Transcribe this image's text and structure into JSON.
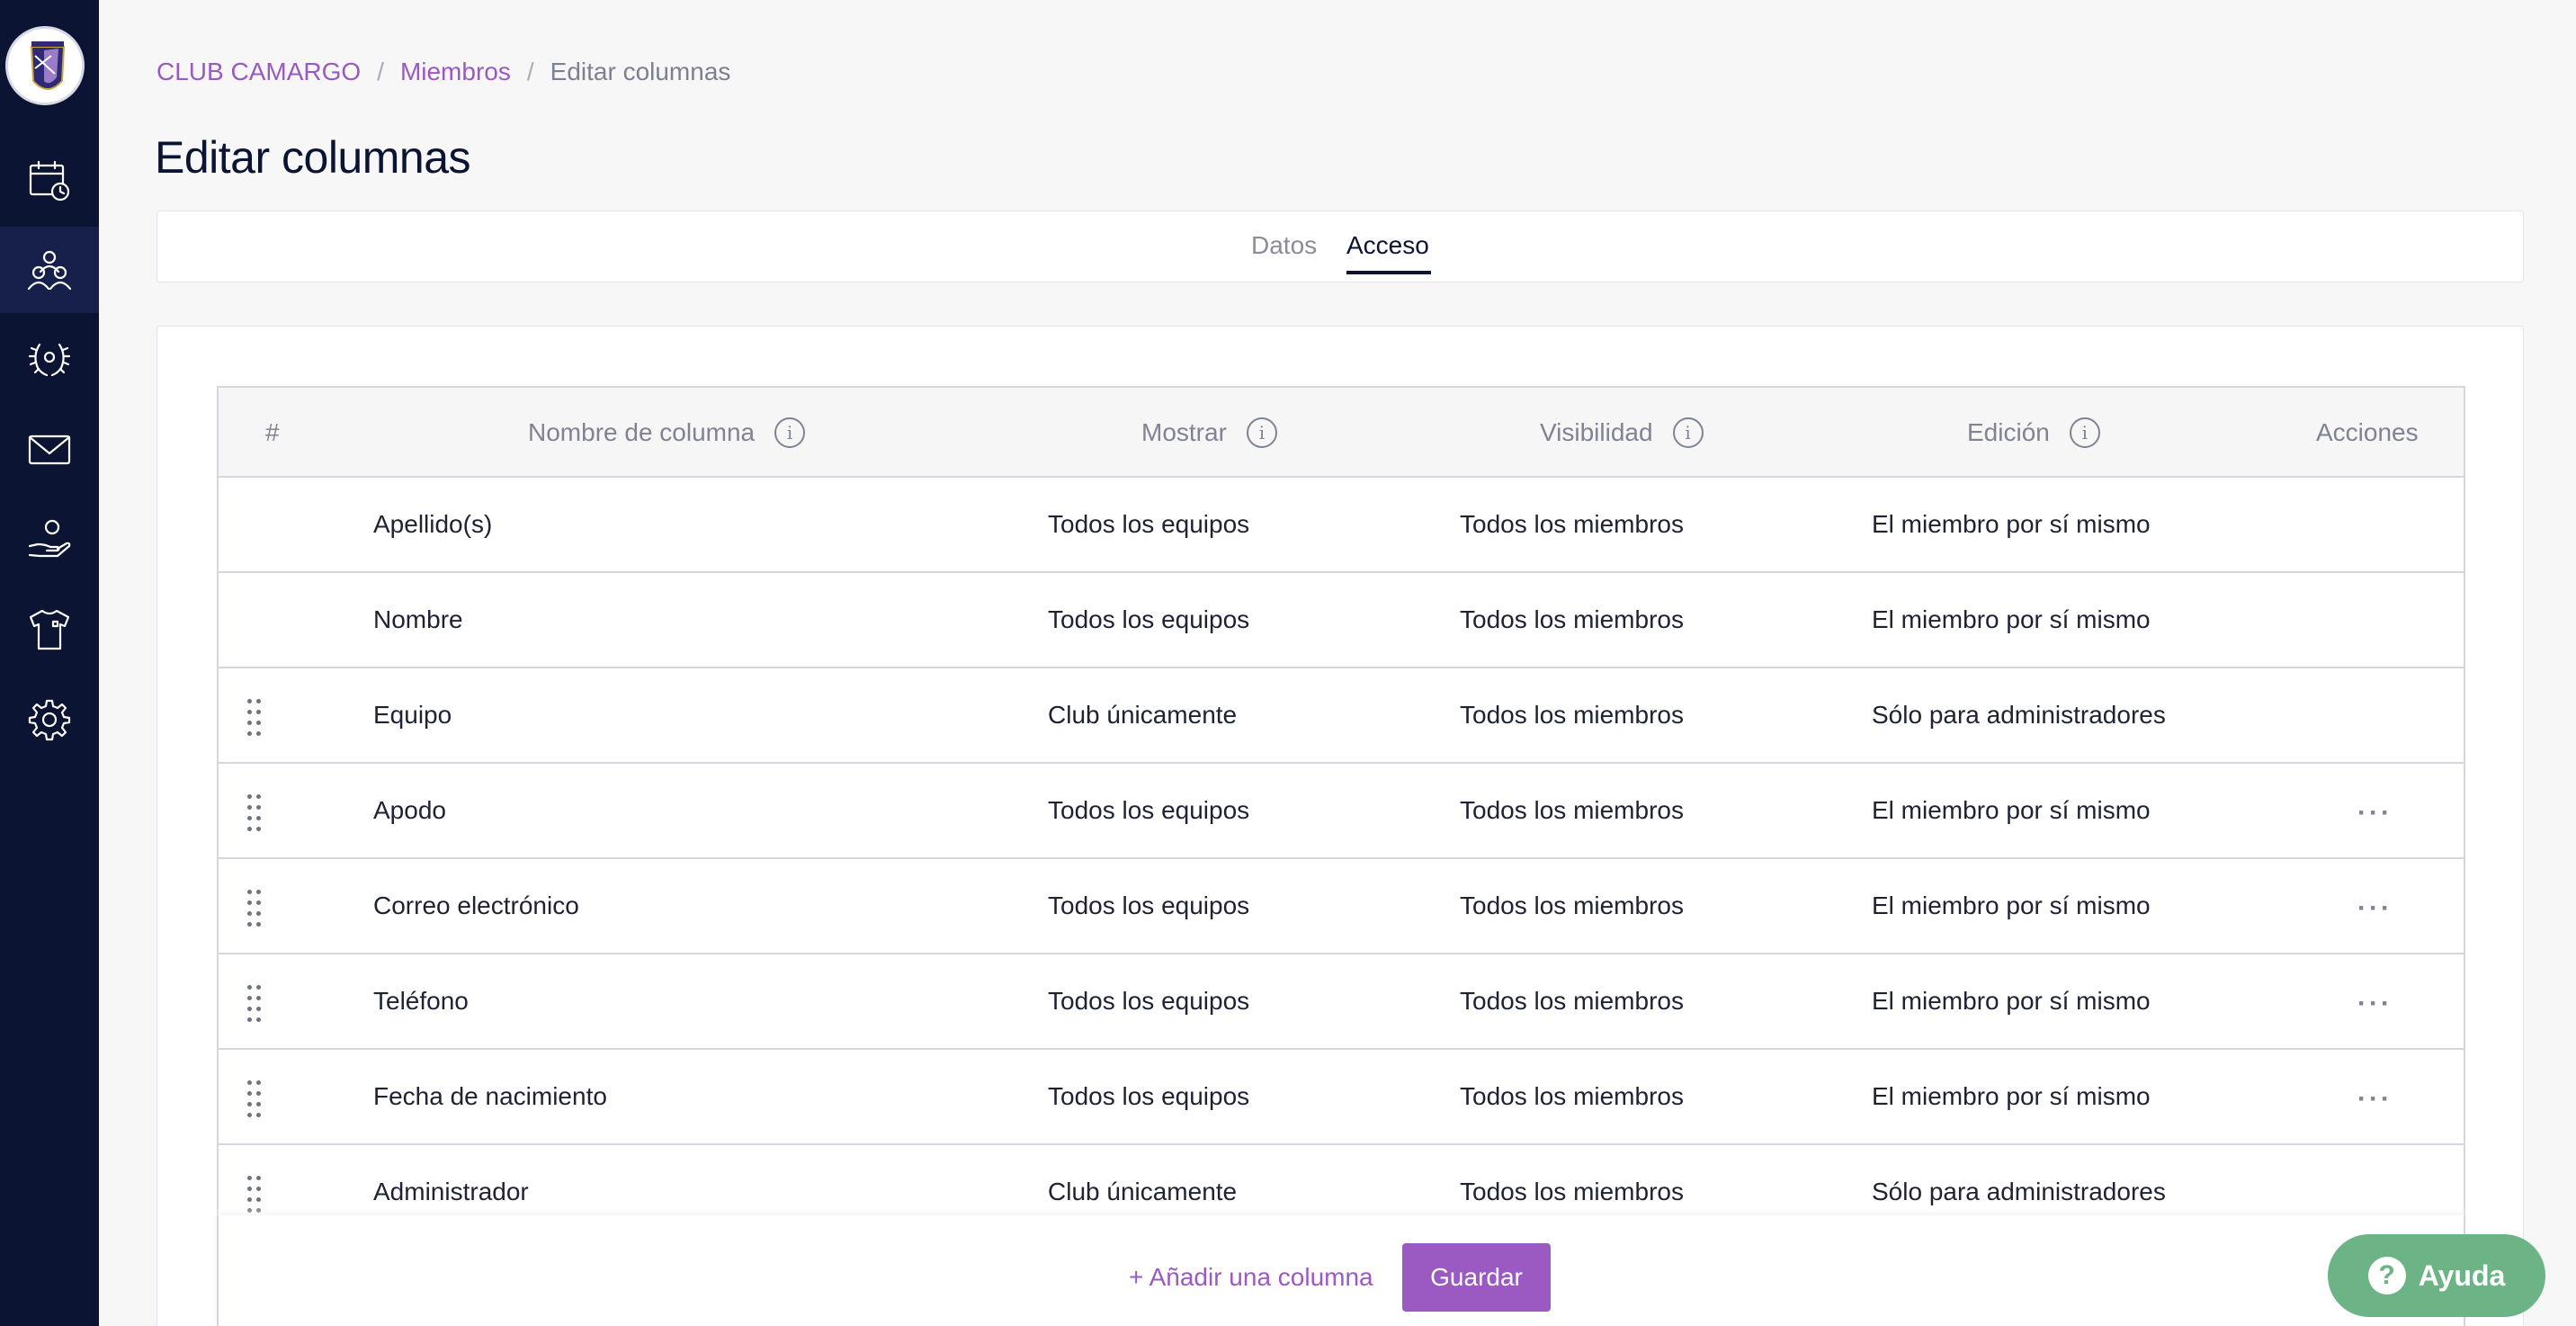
{
  "sidebar": {
    "items": [
      {
        "icon": "calendar-clock-icon"
      },
      {
        "icon": "members-icon",
        "active": true
      },
      {
        "icon": "laurel-icon"
      },
      {
        "icon": "mail-icon"
      },
      {
        "icon": "hand-heart-icon"
      },
      {
        "icon": "shirt-icon"
      },
      {
        "icon": "gear-icon"
      }
    ]
  },
  "breadcrumb": {
    "club": "CLUB CAMARGO",
    "section": "Miembros",
    "current": "Editar columnas",
    "separator": "/"
  },
  "page": {
    "title": "Editar columnas"
  },
  "tabs": [
    {
      "label": "Datos",
      "active": false
    },
    {
      "label": "Acceso",
      "active": true
    }
  ],
  "table": {
    "headers": {
      "index": "#",
      "name": "Nombre de columna",
      "show": "Mostrar",
      "visibility": "Visibilidad",
      "edit": "Edición",
      "actions": "Acciones"
    },
    "info_glyph": "i",
    "rows": [
      {
        "name": "Apellido(s)",
        "show": "Todos los equipos",
        "visibility": "Todos los miembros",
        "edit": "El miembro por sí mismo",
        "draggable": false,
        "actions": false
      },
      {
        "name": "Nombre",
        "show": "Todos los equipos",
        "visibility": "Todos los miembros",
        "edit": "El miembro por sí mismo",
        "draggable": false,
        "actions": false
      },
      {
        "name": "Equipo",
        "show": "Club únicamente",
        "visibility": "Todos los miembros",
        "edit": "Sólo para administradores",
        "draggable": true,
        "actions": false
      },
      {
        "name": "Apodo",
        "show": "Todos los equipos",
        "visibility": "Todos los miembros",
        "edit": "El miembro por sí mismo",
        "draggable": true,
        "actions": true
      },
      {
        "name": "Correo electrónico",
        "show": "Todos los equipos",
        "visibility": "Todos los miembros",
        "edit": "El miembro por sí mismo",
        "draggable": true,
        "actions": true
      },
      {
        "name": "Teléfono",
        "show": "Todos los equipos",
        "visibility": "Todos los miembros",
        "edit": "El miembro por sí mismo",
        "draggable": true,
        "actions": true
      },
      {
        "name": "Fecha de nacimiento",
        "show": "Todos los equipos",
        "visibility": "Todos los miembros",
        "edit": "El miembro por sí mismo",
        "draggable": true,
        "actions": true
      },
      {
        "name": "Administrador",
        "show": "Club únicamente",
        "visibility": "Todos los miembros",
        "edit": "Sólo para administradores",
        "draggable": true,
        "actions": false
      }
    ],
    "actions_glyph": "···"
  },
  "footer": {
    "add_column": "+ Añadir una columna",
    "save": "Guardar"
  },
  "help": {
    "label": "Ayuda",
    "glyph": "?"
  },
  "colors": {
    "sidebar_bg": "#0b1433",
    "accent": "#9b59c2",
    "help_green": "#6cb485"
  }
}
